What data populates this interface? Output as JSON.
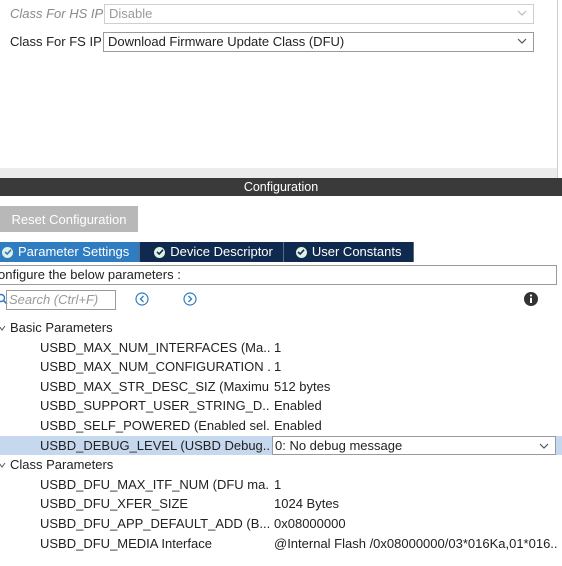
{
  "top": {
    "hs_ip_label": "Class For HS IP",
    "hs_ip_value": "Disable",
    "fs_ip_label": "Class For FS IP",
    "fs_ip_value": "Download Firmware Update Class (DFU)"
  },
  "config_bar_title": "Configuration",
  "reset_button_label": "Reset Configuration",
  "tabs": [
    {
      "label": "Parameter Settings",
      "active": true
    },
    {
      "label": "Device Descriptor",
      "active": false
    },
    {
      "label": "User Constants",
      "active": false
    }
  ],
  "description": "onfigure the below parameters :",
  "search": {
    "placeholder": "Search (Ctrl+F)"
  },
  "groups": [
    {
      "label": "Basic Parameters",
      "params": [
        {
          "name": "USBD_MAX_NUM_INTERFACES (Ma...",
          "value": "1"
        },
        {
          "name": "USBD_MAX_NUM_CONFIGURATION ...",
          "value": "1"
        },
        {
          "name": "USBD_MAX_STR_DESC_SIZ (Maximu...",
          "value": "512 bytes"
        },
        {
          "name": "USBD_SUPPORT_USER_STRING_D...",
          "value": "Enabled"
        },
        {
          "name": "USBD_SELF_POWERED (Enabled sel...",
          "value": "Enabled"
        },
        {
          "name": "USBD_DEBUG_LEVEL (USBD Debug...",
          "value": "0: No debug message",
          "selected": true
        }
      ]
    },
    {
      "label": "Class Parameters",
      "params": [
        {
          "name": "USBD_DFU_MAX_ITF_NUM (DFU ma...",
          "value": "1"
        },
        {
          "name": "USBD_DFU_XFER_SIZE",
          "value": "1024 Bytes"
        },
        {
          "name": "USBD_DFU_APP_DEFAULT_ADD (B...",
          "value": "0x08000000"
        },
        {
          "name": "USBD_DFU_MEDIA Interface",
          "value": "@Internal Flash   /0x08000000/03*016Ka,01*016.."
        }
      ]
    }
  ],
  "colors": {
    "tab_active": "#2f7dc0",
    "tab_inactive": "#102a4f",
    "config_bar": "#3a3a3a",
    "selection": "#c5d8ee"
  }
}
